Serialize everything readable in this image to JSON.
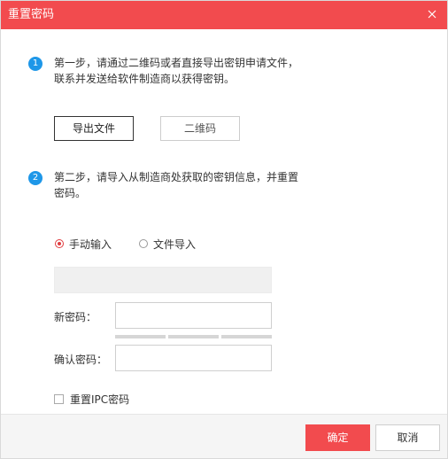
{
  "dialog": {
    "title": "重置密码",
    "close_icon": "close-icon"
  },
  "colors": {
    "accent": "#f24b4e",
    "step_badge": "#1e97e8"
  },
  "step1": {
    "number": "1",
    "line1": "第一步，请通过二维码或者直接导出密钥申请文件，",
    "line2": "联系并发送给软件制造商以获得密钥。",
    "export_button": "导出文件",
    "qrcode_button": "二维码"
  },
  "step2": {
    "number": "2",
    "line1": "第二步，请导入从制造商处获取的密钥信息，并重置",
    "line2": "密码。",
    "radio_manual": "手动输入",
    "radio_file": "文件导入",
    "selected_mode": "手动输入"
  },
  "form": {
    "new_password_label": "新密码：",
    "confirm_password_label": "确认密码：",
    "reset_ipc_label": "重置IPC密码"
  },
  "footer": {
    "ok_label": "确定",
    "cancel_label": "取消"
  }
}
